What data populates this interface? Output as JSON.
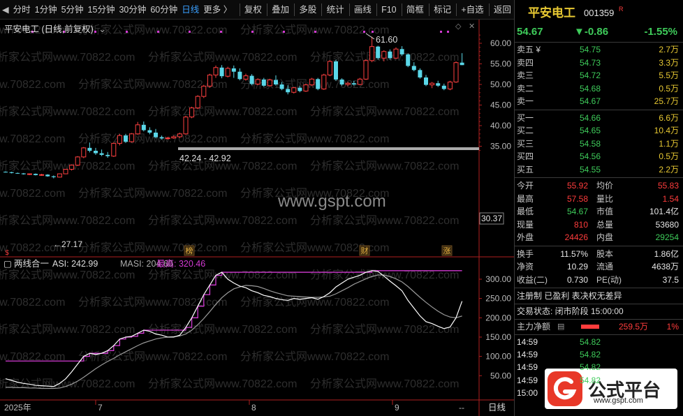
{
  "toolbar": {
    "items": [
      "分时",
      "1分钟",
      "5分钟",
      "15分钟",
      "30分钟",
      "60分钟",
      "日线",
      "更多 〉"
    ],
    "active": "日线",
    "tools": [
      "复权",
      "叠加",
      "多股",
      "统计",
      "画线",
      "F10",
      "简框",
      "标记",
      "+自选",
      "返回"
    ]
  },
  "price_chart": {
    "title": "平安电工 (日线,前复权)",
    "annotations": {
      "high": "61.60",
      "range": "42.24 - 42.92",
      "low": "←27.17",
      "tag_bang": "榜",
      "tag_cai": "财",
      "tag_zhang": "涨",
      "tag_s": "$",
      "watermark": "www.gspt.com"
    },
    "axis_ticks": [
      "60.00",
      "55.00",
      "50.00",
      "45.00",
      "40.00",
      "35.00"
    ],
    "price_marker": "30.37"
  },
  "indicator": {
    "name": "两线合一",
    "asi_label": "ASI: 242.99",
    "masi_label": "MASI: 204.60",
    "max_label": "最高: 320.46",
    "axis_ticks": [
      "300.00",
      "250.00",
      "200.00",
      "150.00",
      "100.00",
      "50.00"
    ]
  },
  "date_axis": {
    "labels": [
      "2025年",
      "7",
      "8",
      "9"
    ],
    "period": "日线",
    "more": "--"
  },
  "watermark_text": "分析家公式网www.70822.com",
  "chart_data": {
    "type": "candlestick",
    "ylim": [
      27,
      63
    ],
    "candles": [
      [
        28.8,
        28.9,
        28.6,
        28.7
      ],
      [
        28.7,
        28.8,
        28.4,
        28.5
      ],
      [
        28.5,
        28.6,
        28.3,
        28.4
      ],
      [
        28.4,
        28.5,
        28.1,
        28.2
      ],
      [
        28.2,
        28.4,
        28.0,
        28.3
      ],
      [
        28.3,
        28.4,
        27.9,
        28.0
      ],
      [
        28.0,
        28.3,
        27.8,
        28.1
      ],
      [
        28.1,
        28.2,
        27.6,
        27.7
      ],
      [
        27.7,
        27.9,
        27.2,
        27.5
      ],
      [
        27.5,
        28.4,
        27.4,
        28.3
      ],
      [
        28.3,
        29.5,
        28.2,
        29.4
      ],
      [
        29.4,
        30.6,
        29.1,
        30.4
      ],
      [
        30.4,
        32.6,
        30.2,
        32.4
      ],
      [
        32.4,
        34.8,
        32.1,
        34.6
      ],
      [
        34.6,
        35.9,
        33.5,
        33.9
      ],
      [
        33.9,
        34.6,
        32.9,
        33.3
      ],
      [
        33.3,
        34.2,
        32.6,
        32.9
      ],
      [
        32.9,
        33.6,
        32.2,
        32.6
      ],
      [
        32.6,
        35.9,
        32.4,
        35.7
      ],
      [
        35.7,
        38.0,
        35.2,
        37.6
      ],
      [
        37.6,
        38.0,
        35.8,
        36.1
      ],
      [
        36.1,
        38.2,
        35.9,
        38.0
      ],
      [
        38.0,
        40.9,
        37.8,
        40.2
      ],
      [
        40.2,
        41.0,
        38.6,
        38.9
      ],
      [
        38.9,
        39.6,
        37.9,
        38.3
      ],
      [
        38.3,
        39.2,
        36.9,
        37.2
      ],
      [
        37.2,
        37.6,
        36.6,
        36.9
      ],
      [
        36.9,
        37.3,
        36.6,
        37.0
      ],
      [
        37.0,
        37.6,
        36.8,
        37.3
      ],
      [
        37.3,
        38.3,
        37.0,
        38.0
      ],
      [
        38.0,
        42.4,
        37.8,
        42.1
      ],
      [
        42.1,
        44.6,
        41.8,
        44.3
      ],
      [
        44.3,
        47.4,
        44.0,
        47.1
      ],
      [
        47.1,
        49.9,
        46.7,
        49.6
      ],
      [
        49.6,
        52.6,
        49.2,
        52.3
      ],
      [
        52.3,
        54.6,
        51.6,
        54.1
      ],
      [
        54.1,
        54.7,
        51.5,
        52.0
      ],
      [
        52.0,
        54.3,
        51.7,
        53.9
      ],
      [
        53.9,
        54.6,
        51.6,
        53.1
      ],
      [
        53.1,
        53.9,
        51.0,
        51.3
      ],
      [
        51.3,
        52.6,
        50.9,
        52.1
      ],
      [
        52.1,
        52.5,
        49.8,
        50.1
      ],
      [
        50.1,
        51.5,
        49.8,
        51.2
      ],
      [
        51.2,
        51.6,
        49.4,
        49.7
      ],
      [
        49.7,
        51.4,
        49.5,
        51.1
      ],
      [
        51.1,
        52.2,
        49.7,
        50.0
      ],
      [
        50.0,
        50.6,
        48.6,
        48.9
      ],
      [
        48.9,
        49.8,
        47.6,
        48.1
      ],
      [
        48.1,
        49.4,
        47.8,
        49.2
      ],
      [
        49.2,
        49.6,
        48.1,
        48.4
      ],
      [
        48.4,
        50.2,
        48.2,
        49.9
      ],
      [
        49.9,
        51.6,
        49.6,
        51.3
      ],
      [
        51.3,
        51.6,
        48.6,
        48.9
      ],
      [
        48.9,
        52.6,
        48.7,
        52.3
      ],
      [
        52.3,
        55.9,
        52.0,
        55.6
      ],
      [
        55.6,
        56.0,
        50.9,
        51.2
      ],
      [
        51.2,
        51.5,
        49.7,
        50.0
      ],
      [
        50.0,
        50.6,
        49.6,
        50.3
      ],
      [
        50.3,
        50.9,
        49.7,
        50.0
      ],
      [
        50.0,
        51.6,
        49.8,
        51.3
      ],
      [
        51.3,
        56.1,
        51.1,
        55.8
      ],
      [
        55.8,
        61.6,
        55.4,
        59.2
      ],
      [
        59.2,
        59.4,
        56.0,
        56.4
      ],
      [
        56.4,
        58.3,
        55.6,
        58.0
      ],
      [
        58.0,
        58.5,
        56.0,
        56.4
      ],
      [
        56.4,
        59.0,
        56.2,
        58.6
      ],
      [
        58.6,
        59.3,
        56.9,
        57.3
      ],
      [
        57.3,
        57.5,
        54.2,
        54.5
      ],
      [
        54.5,
        55.4,
        53.2,
        53.5
      ],
      [
        53.5,
        53.9,
        51.4,
        51.7
      ],
      [
        51.7,
        52.3,
        49.6,
        49.9
      ],
      [
        49.9,
        50.6,
        49.1,
        50.3
      ],
      [
        50.3,
        50.9,
        49.4,
        49.7
      ],
      [
        49.7,
        50.2,
        48.6,
        48.9
      ],
      [
        48.9,
        50.9,
        48.6,
        50.6
      ],
      [
        50.6,
        55.6,
        50.4,
        55.3
      ],
      [
        55.3,
        57.6,
        54.7,
        54.7
      ]
    ],
    "asi": [
      42,
      38,
      33,
      30,
      28,
      25,
      24,
      23,
      22,
      30,
      42,
      60,
      80,
      100,
      108,
      105,
      108,
      115,
      128,
      145,
      150,
      152,
      160,
      168,
      165,
      158,
      155,
      150,
      150,
      155,
      175,
      200,
      230,
      260,
      285,
      310,
      318,
      300,
      290,
      282,
      278,
      270,
      265,
      258,
      255,
      250,
      247,
      245,
      250,
      248,
      250,
      252,
      248,
      255,
      265,
      280,
      290,
      300,
      305,
      310,
      318,
      322,
      320,
      308,
      295,
      283,
      270,
      245,
      225,
      205,
      190,
      185,
      178,
      172,
      176,
      200,
      242.99
    ],
    "masi": [
      20,
      20,
      19,
      19,
      18,
      18,
      17,
      17,
      17,
      18,
      22,
      28,
      36,
      46,
      57,
      68,
      78,
      87,
      95,
      104,
      112,
      120,
      128,
      135,
      140,
      145,
      148,
      150,
      151,
      153,
      158,
      168,
      182,
      198,
      216,
      235,
      252,
      265,
      275,
      280,
      284,
      283,
      281,
      276,
      270,
      265,
      261,
      257,
      256,
      255,
      254,
      253,
      253,
      254,
      256,
      262,
      270,
      278,
      287,
      294,
      301,
      307,
      311,
      311,
      307,
      301,
      293,
      281,
      267,
      253,
      240,
      228,
      217,
      208,
      202,
      200,
      204.6
    ],
    "asi_max": 320.46
  }
}
